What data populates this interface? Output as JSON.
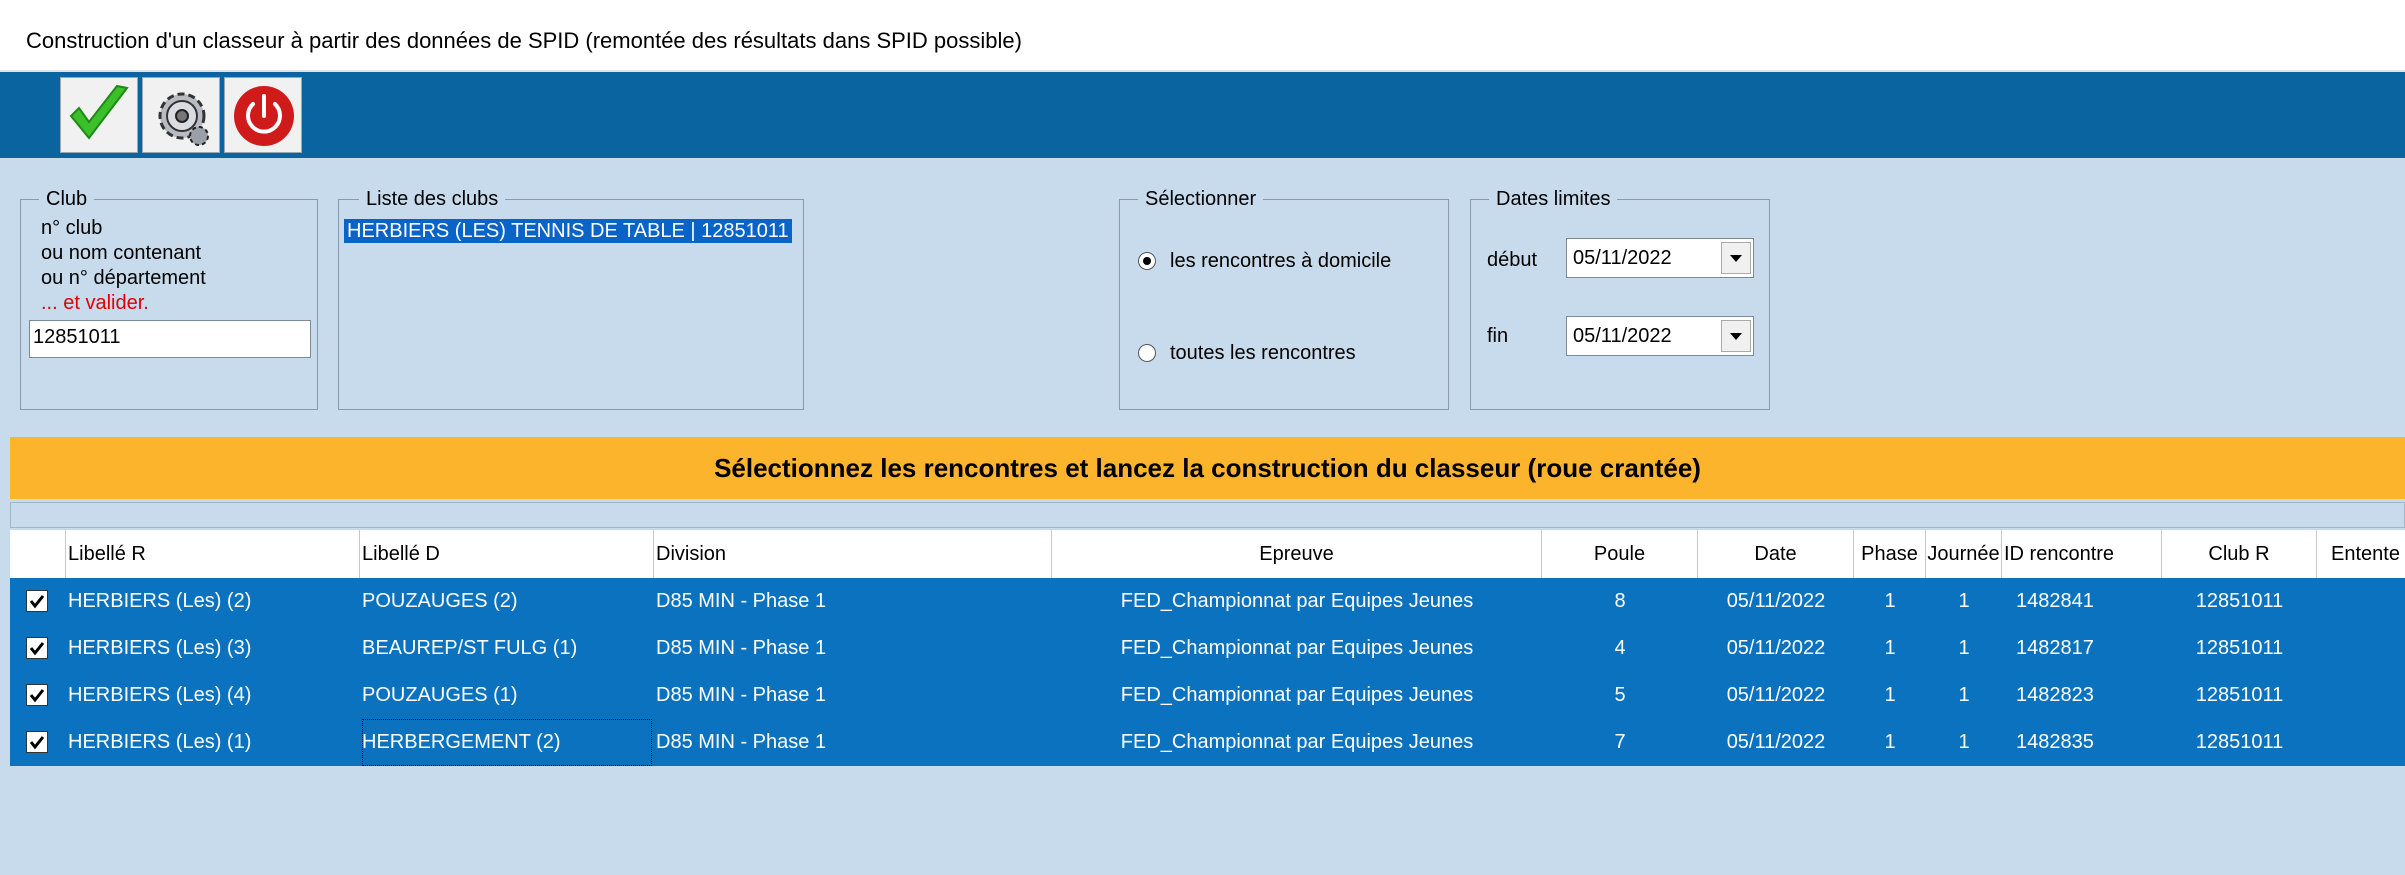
{
  "window": {
    "title": "Construction d'un classeur à partir des données de SPID (remontée des résultats dans SPID possible)"
  },
  "toolbar": {
    "buttons": [
      {
        "icon": "checkmark-icon"
      },
      {
        "icon": "gear-icon"
      },
      {
        "icon": "power-icon"
      }
    ]
  },
  "club_group": {
    "legend": "Club",
    "hint_lines": [
      "n° club",
      "ou nom contenant",
      "ou n° département"
    ],
    "validate_hint": "... et valider.",
    "input_value": "12851011"
  },
  "clubs_list": {
    "legend": "Liste des clubs",
    "items": [
      "HERBIERS (LES) TENNIS DE TABLE | 12851011"
    ]
  },
  "select_group": {
    "legend": "Sélectionner",
    "options": [
      {
        "label": "les rencontres à domicile",
        "selected": true
      },
      {
        "label": "toutes les rencontres",
        "selected": false
      }
    ]
  },
  "dates_group": {
    "legend": "Dates limites",
    "start_label": "début",
    "start_value": "05/11/2022",
    "end_label": "fin",
    "end_value": "05/11/2022"
  },
  "banner": {
    "text": "Sélectionnez les rencontres et lancez la construction du classeur (roue crantée)"
  },
  "grid": {
    "columns": [
      "Libellé R",
      "Libellé D",
      "Division",
      "Epreuve",
      "Poule",
      "Date",
      "Phase",
      "Journée",
      "ID rencontre",
      "Club R",
      "Entente"
    ],
    "rows": [
      {
        "checked": true,
        "libelle_r": "HERBIERS (Les) (2)",
        "libelle_d": "POUZAUGES (2)",
        "division": "D85 MIN - Phase 1",
        "epreuve": "FED_Championnat par Equipes Jeunes",
        "poule": "8",
        "date": "05/11/2022",
        "phase": "1",
        "journee": "1",
        "id": "1482841",
        "club_r": "12851011"
      },
      {
        "checked": true,
        "libelle_r": "HERBIERS (Les) (3)",
        "libelle_d": "BEAUREP/ST FULG (1)",
        "division": "D85 MIN - Phase 1",
        "epreuve": "FED_Championnat par Equipes Jeunes",
        "poule": "4",
        "date": "05/11/2022",
        "phase": "1",
        "journee": "1",
        "id": "1482817",
        "club_r": "12851011"
      },
      {
        "checked": true,
        "libelle_r": "HERBIERS (Les) (4)",
        "libelle_d": "POUZAUGES (1)",
        "division": "D85 MIN - Phase 1",
        "epreuve": "FED_Championnat par Equipes Jeunes",
        "poule": "5",
        "date": "05/11/2022",
        "phase": "1",
        "journee": "1",
        "id": "1482823",
        "club_r": "12851011"
      },
      {
        "checked": true,
        "libelle_r": "HERBIERS (Les) (1)",
        "libelle_d": "HERBERGEMENT (2)",
        "division": "D85 MIN - Phase 1",
        "epreuve": "FED_Championnat par Equipes Jeunes",
        "poule": "7",
        "date": "05/11/2022",
        "phase": "1",
        "journee": "1",
        "id": "1482835",
        "club_r": "12851011"
      }
    ]
  },
  "colors": {
    "toolbar_bg": "#0a64a0",
    "form_bg": "#c7dbec",
    "banner_bg": "#fbb42c",
    "row_selected_bg": "#0a72be",
    "validate_hint": "#e00000"
  }
}
